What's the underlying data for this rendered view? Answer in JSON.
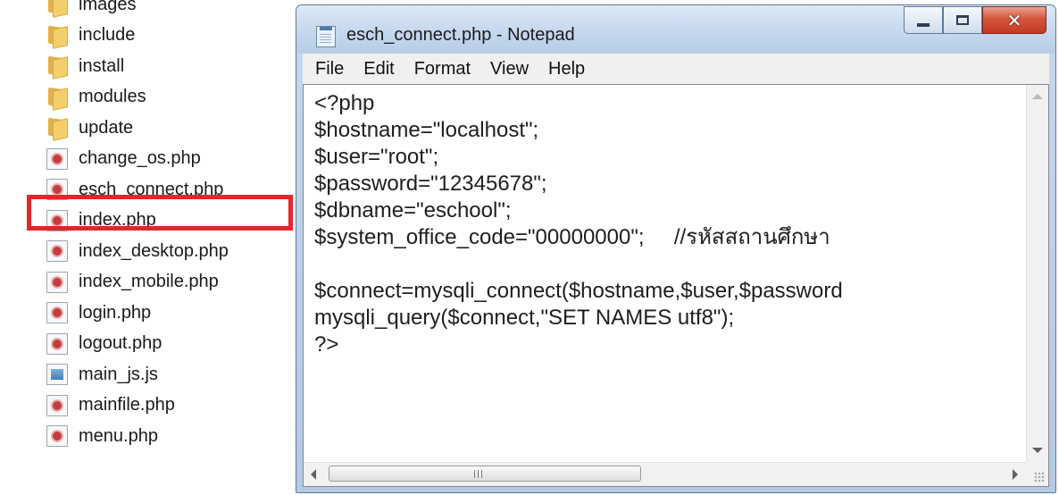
{
  "explorer": {
    "files": [
      {
        "name": "images",
        "type": "folder"
      },
      {
        "name": "include",
        "type": "folder"
      },
      {
        "name": "install",
        "type": "folder"
      },
      {
        "name": "modules",
        "type": "folder"
      },
      {
        "name": "update",
        "type": "folder"
      },
      {
        "name": "change_os.php",
        "type": "php"
      },
      {
        "name": "esch_connect.php",
        "type": "php",
        "highlighted": true
      },
      {
        "name": "index.php",
        "type": "php"
      },
      {
        "name": "index_desktop.php",
        "type": "php"
      },
      {
        "name": "index_mobile.php",
        "type": "php"
      },
      {
        "name": "login.php",
        "type": "php"
      },
      {
        "name": "logout.php",
        "type": "php"
      },
      {
        "name": "main_js.js",
        "type": "js"
      },
      {
        "name": "mainfile.php",
        "type": "php"
      },
      {
        "name": "menu.php",
        "type": "php"
      }
    ],
    "highlight_color": "#e3262b"
  },
  "notepad": {
    "title": "esch_connect.php - Notepad",
    "icon": "notepad-icon",
    "menu": [
      "File",
      "Edit",
      "Format",
      "View",
      "Help"
    ],
    "code_lines": [
      "<?php",
      "$hostname=\"localhost\";",
      "$user=\"root\";",
      "$password=\"12345678\";",
      "$dbname=\"eschool\";",
      "$system_office_code=\"00000000\";     //รหัสสถานศึกษา",
      "",
      "$connect=mysqli_connect($hostname,$user,$password",
      "mysqli_query($connect,\"SET NAMES utf8\");",
      "?>"
    ],
    "controls": {
      "minimize": "minimize-icon",
      "maximize": "maximize-icon",
      "close": "close-icon"
    },
    "close_color": "#c33a22"
  }
}
